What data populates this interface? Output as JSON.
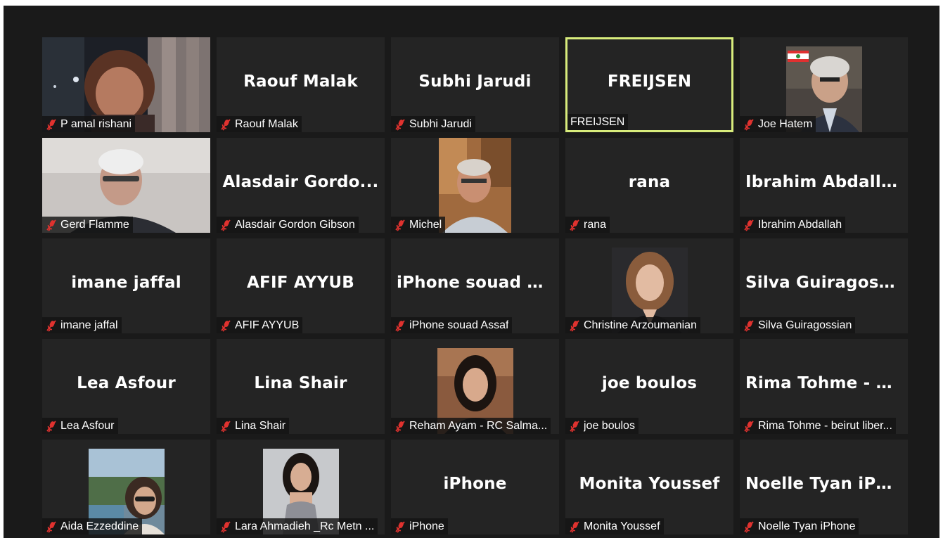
{
  "participants": [
    {
      "name": "P amal rishani",
      "muted": true,
      "video": true
    },
    {
      "name": "Raouf Malak",
      "display": "Raouf Malak",
      "muted": true,
      "video": false
    },
    {
      "name": "Subhi Jarudi",
      "display": "Subhi Jarudi",
      "muted": true,
      "video": false
    },
    {
      "name": "FREIJSEN",
      "display": "FREIJSEN",
      "muted": false,
      "video": false,
      "active_speaker": true
    },
    {
      "name": "Joe Hatem",
      "muted": true,
      "video": true
    },
    {
      "name": "Gerd Flamme",
      "muted": true,
      "video": true
    },
    {
      "name": "Alasdair Gordon Gibson",
      "display": "Alasdair  Gordo...",
      "muted": true,
      "video": false
    },
    {
      "name": "Michel",
      "muted": true,
      "video": true
    },
    {
      "name": "rana",
      "display": "rana",
      "muted": true,
      "video": false
    },
    {
      "name": "Ibrahim Abdallah",
      "display": "Ibrahim Abdallah",
      "muted": true,
      "video": false
    },
    {
      "name": "imane jaffal",
      "display": "imane jaffal",
      "muted": true,
      "video": false
    },
    {
      "name": "AFIF AYYUB",
      "display": "AFIF AYYUB",
      "muted": true,
      "video": false
    },
    {
      "name": "iPhone souad Assaf",
      "display": "iPhone  souad  A...",
      "muted": true,
      "video": false
    },
    {
      "name": "Christine Arzoumanian",
      "muted": true,
      "video": true
    },
    {
      "name": "Silva Guiragossian",
      "display": "Silva  Guiragossi...",
      "muted": true,
      "video": false
    },
    {
      "name": "Lea Asfour",
      "display": "Lea Asfour",
      "muted": true,
      "video": false
    },
    {
      "name": "Lina Shair",
      "display": "Lina Shair",
      "muted": true,
      "video": false
    },
    {
      "name": "Reham Ayam - RC Salma...",
      "muted": true,
      "video": true
    },
    {
      "name": "joe boulos",
      "display": "joe boulos",
      "muted": true,
      "video": false
    },
    {
      "name": "Rima Tohme - beirut liber...",
      "display": "Rima  Tohme  -  b...",
      "muted": true,
      "video": false
    },
    {
      "name": "Aida Ezzeddine",
      "muted": true,
      "video": true
    },
    {
      "name": "Lara Ahmadieh _Rc Metn ...",
      "muted": true,
      "video": true
    },
    {
      "name": "iPhone",
      "display": "iPhone",
      "muted": true,
      "video": false
    },
    {
      "name": "Monita Youssef",
      "display": "Monita Youssef",
      "muted": true,
      "video": false
    },
    {
      "name": "Noelle Tyan iPhone",
      "display": "Noelle  Tyan  iPh...",
      "muted": true,
      "video": false
    }
  ],
  "colors": {
    "background": "#1a1a1a",
    "tile": "#242424",
    "active_speaker_border": "#d8ec7c",
    "muted_icon": "#e0322f"
  }
}
